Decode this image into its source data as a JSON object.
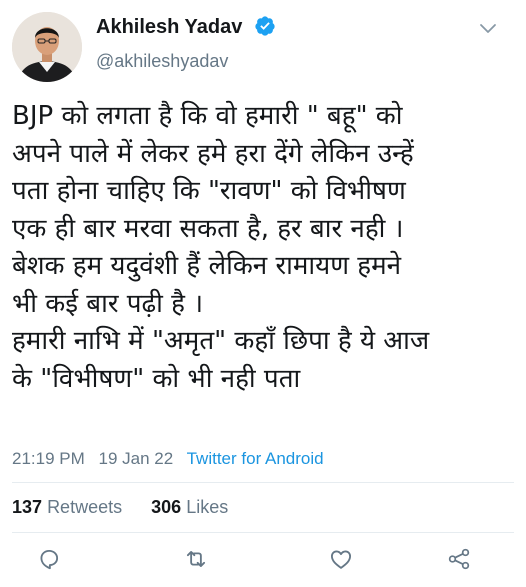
{
  "user": {
    "name": "Akhilesh Yadav",
    "handle": "@akhileshyadav"
  },
  "tweet": {
    "lines": [
      "BJP को लगता है कि वो हमारी \" बहू\" को",
      "अपने पाले में लेकर हमे हरा देंगे लेकिन उन्हें",
      "पता होना चाहिए कि \"रावण\" को विभीषण",
      "एक ही बार मरवा सकता है, हर बार नही ।",
      "बेशक हम यदुवंशी हैं लेकिन रामायण हमने",
      "भी कई बार पढ़ी है ।",
      "हमारी नाभि में \"अमृत\" कहाँ छिपा है ये आज",
      "के \"विभीषण\" को भी नही पता"
    ]
  },
  "meta": {
    "time": "21:19 PM",
    "date": "19 Jan 22",
    "source": "Twitter for Android"
  },
  "stats": {
    "retweets_count": "137",
    "retweets_label": "Retweets",
    "likes_count": "306",
    "likes_label": "Likes"
  },
  "icons": {
    "verified": "verified-badge-icon",
    "menu": "chevron-down-icon",
    "reply": "reply-icon",
    "retweet": "retweet-icon",
    "like": "heart-icon",
    "share": "share-icon"
  },
  "colors": {
    "verified": "#1da1f2",
    "secondary_text": "#657786",
    "link": "#1b95e0",
    "divider": "#e6ecf0"
  }
}
